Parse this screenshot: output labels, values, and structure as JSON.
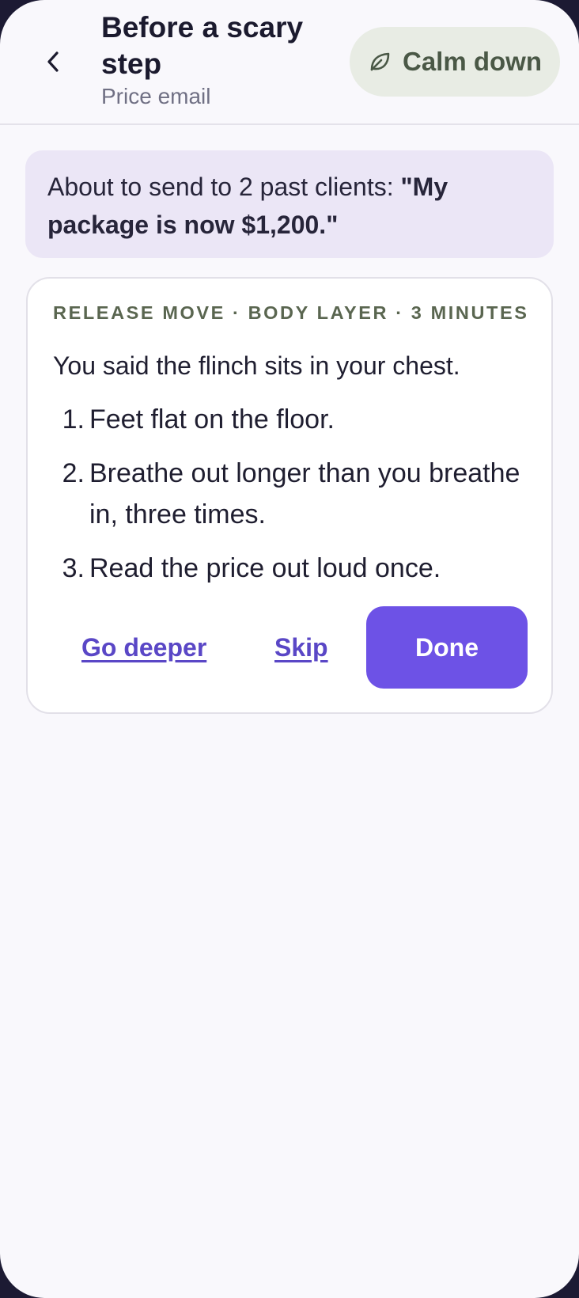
{
  "header": {
    "title": "Before a scary step",
    "subtitle": "Price email",
    "back_icon": "chevron-left-icon",
    "calm_button": {
      "icon": "leaf-icon",
      "label": "Calm down"
    }
  },
  "banner": {
    "prefix": "About to send to 2 past clients: ",
    "quote": "\"My package is now $1,200.\""
  },
  "card": {
    "eyebrow": "RELEASE MOVE · BODY LAYER · 3 MINUTES",
    "intro": "You said the flinch sits in your chest.",
    "steps": [
      {
        "num": "1.",
        "text": "Feet flat on the floor."
      },
      {
        "num": "2.",
        "text": "Breathe out longer than you breathe in, three times."
      },
      {
        "num": "3.",
        "text": "Read the price out loud once."
      }
    ],
    "actions": {
      "go_deeper": "Go deeper",
      "skip": "Skip",
      "done": "Done"
    }
  },
  "colors": {
    "accent": "#6d52e6",
    "link": "#5a47c6",
    "calm_bg": "#e8ece4",
    "banner_bg": "#ebe6f6"
  }
}
